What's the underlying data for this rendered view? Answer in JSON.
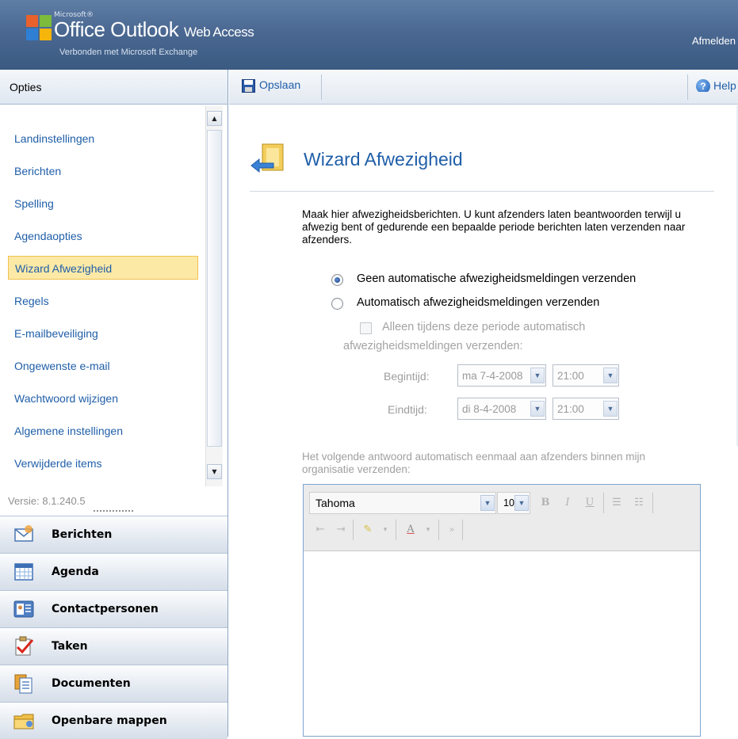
{
  "header": {
    "microsoft": "Microsoft®",
    "product": "Office Outlook",
    "product_suffix": "Web Access",
    "connected": "Verbonden met Microsoft Exchange",
    "signout": "Afmelden"
  },
  "sidebar": {
    "title": "Opties",
    "items": [
      {
        "label": "Landinstellingen"
      },
      {
        "label": "Berichten"
      },
      {
        "label": "Spelling"
      },
      {
        "label": "Agendaopties"
      },
      {
        "label": "Wizard Afwezigheid",
        "selected": true
      },
      {
        "label": "Regels"
      },
      {
        "label": "E-mailbeveiliging"
      },
      {
        "label": "Ongewenste e-mail"
      },
      {
        "label": "Wachtwoord wijzigen"
      },
      {
        "label": "Algemene instellingen"
      },
      {
        "label": "Verwijderde items"
      }
    ],
    "version": "Versie: 8.1.240.5",
    "modules": [
      {
        "label": "Berichten",
        "icon": "mail-icon"
      },
      {
        "label": "Agenda",
        "icon": "calendar-icon"
      },
      {
        "label": "Contactpersonen",
        "icon": "contacts-icon"
      },
      {
        "label": "Taken",
        "icon": "tasks-icon"
      },
      {
        "label": "Documenten",
        "icon": "documents-icon"
      },
      {
        "label": "Openbare mappen",
        "icon": "public-folders-icon"
      }
    ]
  },
  "toolbar": {
    "save_label": "Opslaan",
    "help_label": "Help"
  },
  "wizard": {
    "title": "Wizard Afwezigheid",
    "intro": "Maak hier afwezigheidsberichten. U kunt afzenders laten beantwoorden terwijl u afwezig bent of gedurende een bepaalde periode berichten laten verzenden naar afzenders.",
    "radio_off": "Geen automatische afwezigheidsmeldingen verzenden",
    "radio_on": "Automatisch afwezigheidsmeldingen verzenden",
    "selected_option": "radio_off",
    "period_check_line1": "Alleen tijdens deze periode automatisch",
    "period_check_line2": "afwezigheidsmeldingen verzenden:",
    "start_label": "Begintijd:",
    "start_date": "ma 7-4-2008",
    "start_time": "21:00",
    "end_label": "Eindtijd:",
    "end_date": "di 8-4-2008",
    "end_time": "21:00",
    "reply_label": "Het volgende antwoord automatisch eenmaal aan afzenders binnen mijn organisatie verzenden:"
  },
  "editor": {
    "font": "Tahoma",
    "size": "10",
    "bold": "B",
    "italic": "I",
    "underline": "U"
  },
  "colors": {
    "link_blue": "#1f5ea8",
    "selected_bg": "#fde9a6",
    "header_blue": "#4a6891"
  }
}
